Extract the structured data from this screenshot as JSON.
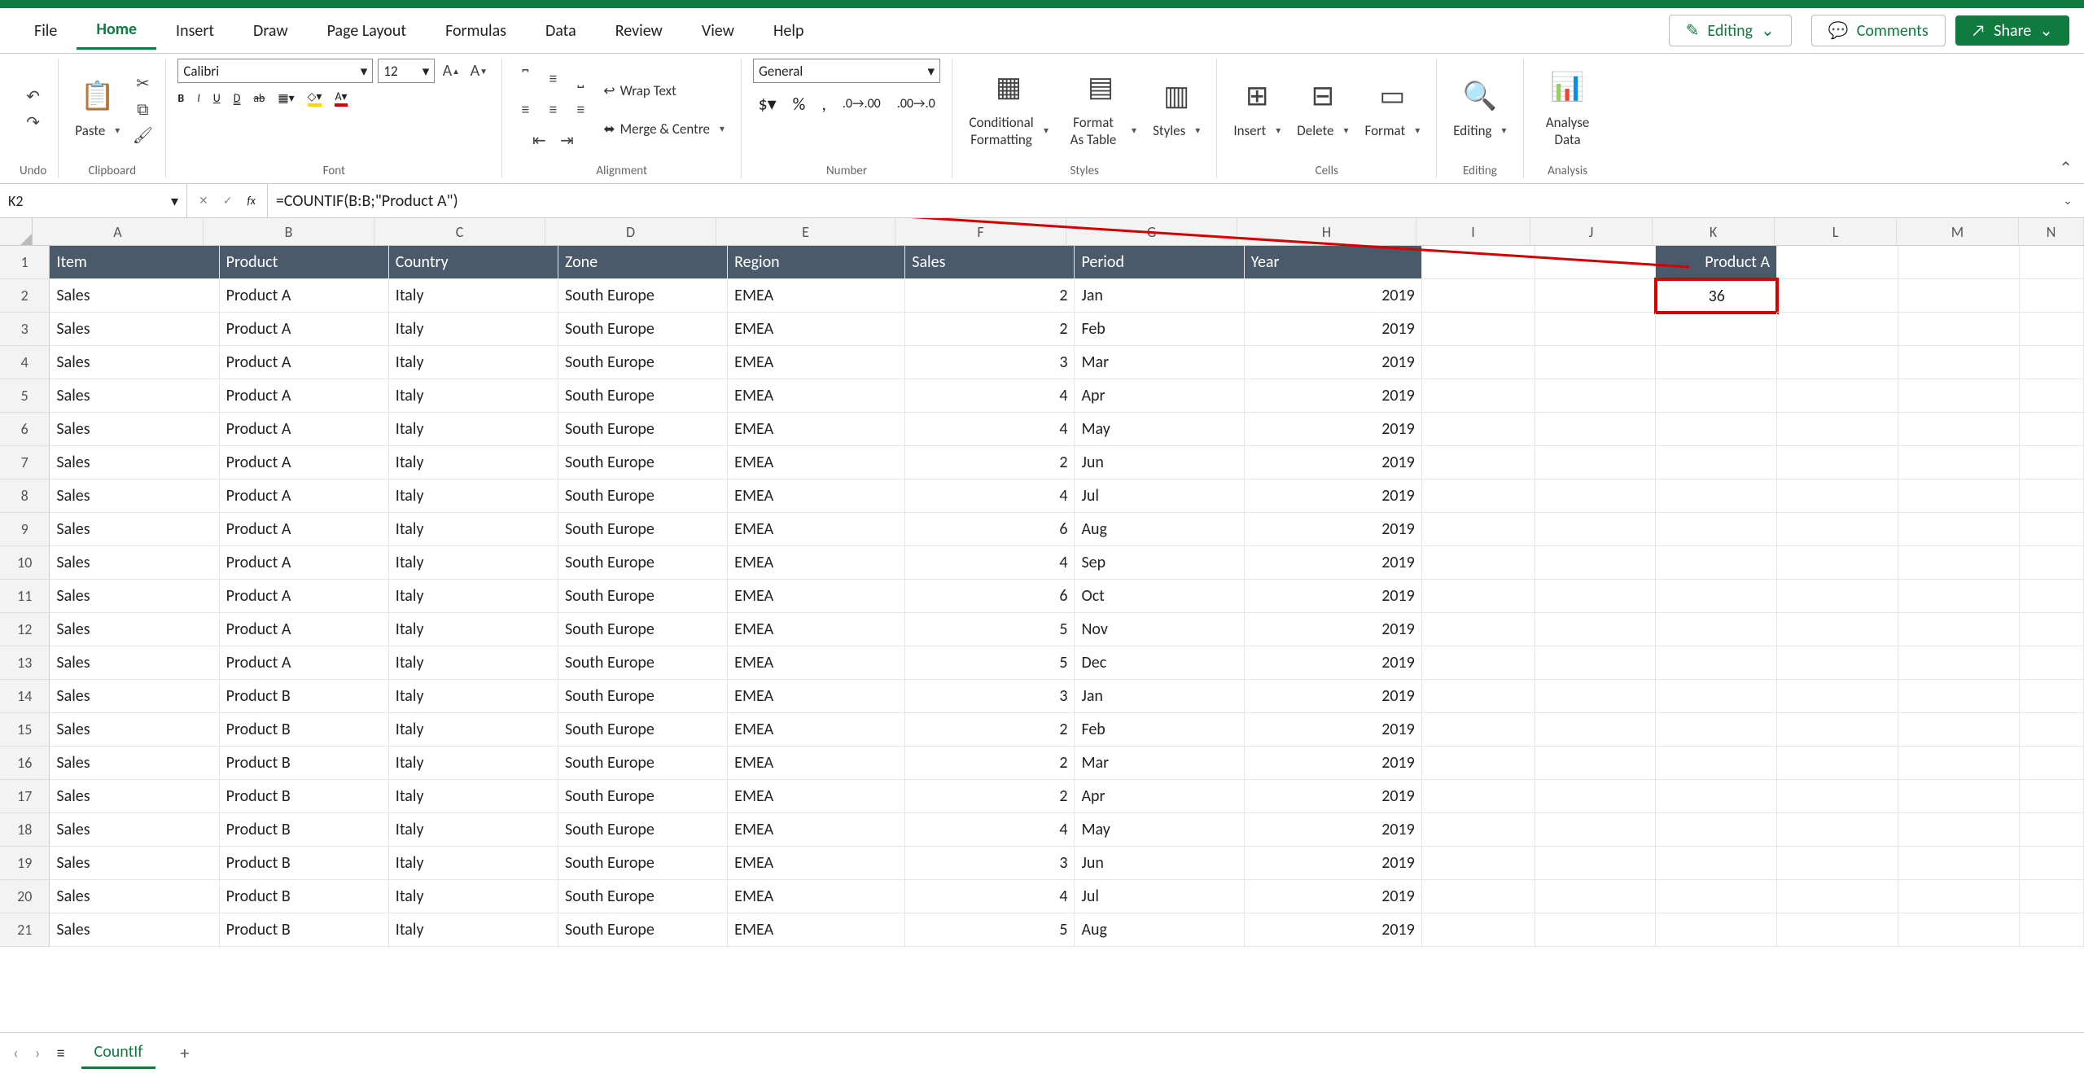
{
  "menu": {
    "file": "File",
    "home": "Home",
    "insert": "Insert",
    "draw": "Draw",
    "pagelayout": "Page Layout",
    "formulas": "Formulas",
    "data": "Data",
    "review": "Review",
    "view": "View",
    "help": "Help"
  },
  "actions": {
    "editing": "Editing",
    "comments": "Comments",
    "share": "Share"
  },
  "ribbon": {
    "undo": "Undo",
    "clipboard": "Clipboard",
    "paste": "Paste",
    "font": "Font",
    "font_name": "Calibri",
    "font_size": "12",
    "alignment": "Alignment",
    "wrap": "Wrap Text",
    "merge": "Merge & Centre",
    "number": "Number",
    "number_format": "General",
    "styles": "Styles",
    "cond": "Conditional Formatting",
    "fmt_table": "Format As Table",
    "styles_btn": "Styles",
    "cells": "Cells",
    "insert": "Insert",
    "delete": "Delete",
    "format": "Format",
    "editing_grp": "Editing",
    "editing_btn": "Editing",
    "analysis": "Analysis",
    "analyse": "Analyse Data"
  },
  "namebox": "K2",
  "formula": "=COUNTIF(B:B;\"Product A\")",
  "sheet": "CountIf",
  "columns": [
    "A",
    "B",
    "C",
    "D",
    "E",
    "F",
    "G",
    "H",
    "I",
    "J",
    "K",
    "L",
    "M",
    "N"
  ],
  "header_row": [
    "Item",
    "Product",
    "Country",
    "Zone",
    "Region",
    "Sales",
    "Period",
    "Year"
  ],
  "k1": "Product A",
  "k2": "36",
  "rows": [
    {
      "n": 2,
      "c": [
        "Sales",
        "Product A",
        "Italy",
        "South Europe",
        "EMEA",
        "2",
        "Jan",
        "2019"
      ]
    },
    {
      "n": 3,
      "c": [
        "Sales",
        "Product A",
        "Italy",
        "South Europe",
        "EMEA",
        "2",
        "Feb",
        "2019"
      ]
    },
    {
      "n": 4,
      "c": [
        "Sales",
        "Product A",
        "Italy",
        "South Europe",
        "EMEA",
        "3",
        "Mar",
        "2019"
      ]
    },
    {
      "n": 5,
      "c": [
        "Sales",
        "Product A",
        "Italy",
        "South Europe",
        "EMEA",
        "4",
        "Apr",
        "2019"
      ]
    },
    {
      "n": 6,
      "c": [
        "Sales",
        "Product A",
        "Italy",
        "South Europe",
        "EMEA",
        "4",
        "May",
        "2019"
      ]
    },
    {
      "n": 7,
      "c": [
        "Sales",
        "Product A",
        "Italy",
        "South Europe",
        "EMEA",
        "2",
        "Jun",
        "2019"
      ]
    },
    {
      "n": 8,
      "c": [
        "Sales",
        "Product A",
        "Italy",
        "South Europe",
        "EMEA",
        "4",
        "Jul",
        "2019"
      ]
    },
    {
      "n": 9,
      "c": [
        "Sales",
        "Product A",
        "Italy",
        "South Europe",
        "EMEA",
        "6",
        "Aug",
        "2019"
      ]
    },
    {
      "n": 10,
      "c": [
        "Sales",
        "Product A",
        "Italy",
        "South Europe",
        "EMEA",
        "4",
        "Sep",
        "2019"
      ]
    },
    {
      "n": 11,
      "c": [
        "Sales",
        "Product A",
        "Italy",
        "South Europe",
        "EMEA",
        "6",
        "Oct",
        "2019"
      ]
    },
    {
      "n": 12,
      "c": [
        "Sales",
        "Product A",
        "Italy",
        "South Europe",
        "EMEA",
        "5",
        "Nov",
        "2019"
      ]
    },
    {
      "n": 13,
      "c": [
        "Sales",
        "Product A",
        "Italy",
        "South Europe",
        "EMEA",
        "5",
        "Dec",
        "2019"
      ]
    },
    {
      "n": 14,
      "c": [
        "Sales",
        "Product B",
        "Italy",
        "South Europe",
        "EMEA",
        "3",
        "Jan",
        "2019"
      ]
    },
    {
      "n": 15,
      "c": [
        "Sales",
        "Product B",
        "Italy",
        "South Europe",
        "EMEA",
        "2",
        "Feb",
        "2019"
      ]
    },
    {
      "n": 16,
      "c": [
        "Sales",
        "Product B",
        "Italy",
        "South Europe",
        "EMEA",
        "2",
        "Mar",
        "2019"
      ]
    },
    {
      "n": 17,
      "c": [
        "Sales",
        "Product B",
        "Italy",
        "South Europe",
        "EMEA",
        "2",
        "Apr",
        "2019"
      ]
    },
    {
      "n": 18,
      "c": [
        "Sales",
        "Product B",
        "Italy",
        "South Europe",
        "EMEA",
        "4",
        "May",
        "2019"
      ]
    },
    {
      "n": 19,
      "c": [
        "Sales",
        "Product B",
        "Italy",
        "South Europe",
        "EMEA",
        "3",
        "Jun",
        "2019"
      ]
    },
    {
      "n": 20,
      "c": [
        "Sales",
        "Product B",
        "Italy",
        "South Europe",
        "EMEA",
        "4",
        "Jul",
        "2019"
      ]
    },
    {
      "n": 21,
      "c": [
        "Sales",
        "Product B",
        "Italy",
        "South Europe",
        "EMEA",
        "5",
        "Aug",
        "2019"
      ]
    }
  ]
}
